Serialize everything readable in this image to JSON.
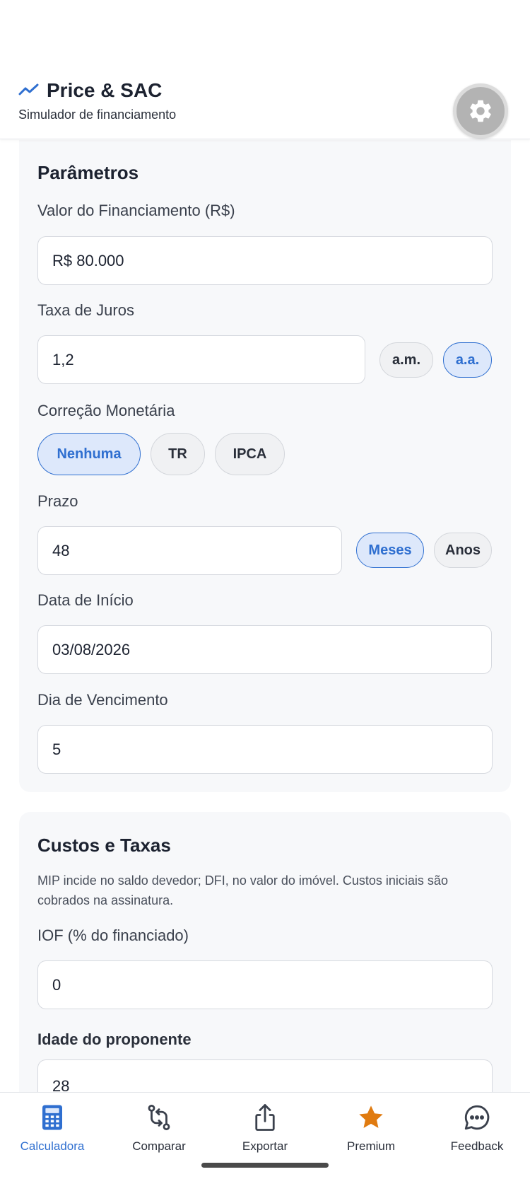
{
  "header": {
    "title": "Price & SAC",
    "subtitle": "Simulador de financiamento"
  },
  "parametros": {
    "title": "Parâmetros",
    "valor_label": "Valor do Financiamento (R$)",
    "valor_value": "R$ 80.000",
    "taxa_label": "Taxa de Juros",
    "taxa_value": "1,2",
    "taxa_options": [
      "a.m.",
      "a.a."
    ],
    "taxa_selected": "a.a.",
    "correcao_label": "Correção Monetária",
    "correcao_options": [
      "Nenhuma",
      "TR",
      "IPCA"
    ],
    "correcao_selected": "Nenhuma",
    "prazo_label": "Prazo",
    "prazo_value": "48",
    "prazo_options": [
      "Meses",
      "Anos"
    ],
    "prazo_selected": "Meses",
    "data_label": "Data de Início",
    "data_value": "03/08/2026",
    "dia_label": "Dia de Vencimento",
    "dia_value": "5"
  },
  "custos": {
    "title": "Custos e Taxas",
    "note": "MIP incide no saldo devedor; DFI, no valor do imóvel. Custos iniciais são cobrados na assinatura.",
    "iof_label": "IOF (% do financiado)",
    "iof_value": "0",
    "idade_label": "Idade do proponente",
    "idade_value": "28"
  },
  "nav": {
    "items": [
      {
        "label": "Calculadora",
        "icon": "calculator-icon",
        "active": true
      },
      {
        "label": "Comparar",
        "icon": "compare-icon",
        "active": false
      },
      {
        "label": "Exportar",
        "icon": "share-icon",
        "active": false
      },
      {
        "label": "Premium",
        "icon": "star-icon",
        "active": false
      },
      {
        "label": "Feedback",
        "icon": "chat-icon",
        "active": false
      }
    ]
  },
  "colors": {
    "accent": "#2f6fd0",
    "accent_bg": "#dde8fb",
    "premium": "#e07b10",
    "gear_bg": "#b3b3b3"
  }
}
